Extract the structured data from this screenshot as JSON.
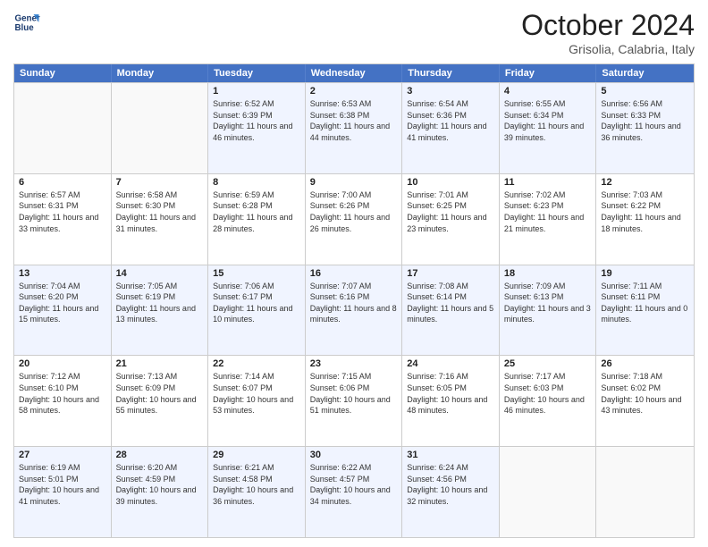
{
  "header": {
    "logo_line1": "General",
    "logo_line2": "Blue",
    "month": "October 2024",
    "location": "Grisolia, Calabria, Italy"
  },
  "weekdays": [
    "Sunday",
    "Monday",
    "Tuesday",
    "Wednesday",
    "Thursday",
    "Friday",
    "Saturday"
  ],
  "rows": [
    [
      {
        "day": "",
        "content": ""
      },
      {
        "day": "",
        "content": ""
      },
      {
        "day": "1",
        "content": "Sunrise: 6:52 AM\nSunset: 6:39 PM\nDaylight: 11 hours and 46 minutes."
      },
      {
        "day": "2",
        "content": "Sunrise: 6:53 AM\nSunset: 6:38 PM\nDaylight: 11 hours and 44 minutes."
      },
      {
        "day": "3",
        "content": "Sunrise: 6:54 AM\nSunset: 6:36 PM\nDaylight: 11 hours and 41 minutes."
      },
      {
        "day": "4",
        "content": "Sunrise: 6:55 AM\nSunset: 6:34 PM\nDaylight: 11 hours and 39 minutes."
      },
      {
        "day": "5",
        "content": "Sunrise: 6:56 AM\nSunset: 6:33 PM\nDaylight: 11 hours and 36 minutes."
      }
    ],
    [
      {
        "day": "6",
        "content": "Sunrise: 6:57 AM\nSunset: 6:31 PM\nDaylight: 11 hours and 33 minutes."
      },
      {
        "day": "7",
        "content": "Sunrise: 6:58 AM\nSunset: 6:30 PM\nDaylight: 11 hours and 31 minutes."
      },
      {
        "day": "8",
        "content": "Sunrise: 6:59 AM\nSunset: 6:28 PM\nDaylight: 11 hours and 28 minutes."
      },
      {
        "day": "9",
        "content": "Sunrise: 7:00 AM\nSunset: 6:26 PM\nDaylight: 11 hours and 26 minutes."
      },
      {
        "day": "10",
        "content": "Sunrise: 7:01 AM\nSunset: 6:25 PM\nDaylight: 11 hours and 23 minutes."
      },
      {
        "day": "11",
        "content": "Sunrise: 7:02 AM\nSunset: 6:23 PM\nDaylight: 11 hours and 21 minutes."
      },
      {
        "day": "12",
        "content": "Sunrise: 7:03 AM\nSunset: 6:22 PM\nDaylight: 11 hours and 18 minutes."
      }
    ],
    [
      {
        "day": "13",
        "content": "Sunrise: 7:04 AM\nSunset: 6:20 PM\nDaylight: 11 hours and 15 minutes."
      },
      {
        "day": "14",
        "content": "Sunrise: 7:05 AM\nSunset: 6:19 PM\nDaylight: 11 hours and 13 minutes."
      },
      {
        "day": "15",
        "content": "Sunrise: 7:06 AM\nSunset: 6:17 PM\nDaylight: 11 hours and 10 minutes."
      },
      {
        "day": "16",
        "content": "Sunrise: 7:07 AM\nSunset: 6:16 PM\nDaylight: 11 hours and 8 minutes."
      },
      {
        "day": "17",
        "content": "Sunrise: 7:08 AM\nSunset: 6:14 PM\nDaylight: 11 hours and 5 minutes."
      },
      {
        "day": "18",
        "content": "Sunrise: 7:09 AM\nSunset: 6:13 PM\nDaylight: 11 hours and 3 minutes."
      },
      {
        "day": "19",
        "content": "Sunrise: 7:11 AM\nSunset: 6:11 PM\nDaylight: 11 hours and 0 minutes."
      }
    ],
    [
      {
        "day": "20",
        "content": "Sunrise: 7:12 AM\nSunset: 6:10 PM\nDaylight: 10 hours and 58 minutes."
      },
      {
        "day": "21",
        "content": "Sunrise: 7:13 AM\nSunset: 6:09 PM\nDaylight: 10 hours and 55 minutes."
      },
      {
        "day": "22",
        "content": "Sunrise: 7:14 AM\nSunset: 6:07 PM\nDaylight: 10 hours and 53 minutes."
      },
      {
        "day": "23",
        "content": "Sunrise: 7:15 AM\nSunset: 6:06 PM\nDaylight: 10 hours and 51 minutes."
      },
      {
        "day": "24",
        "content": "Sunrise: 7:16 AM\nSunset: 6:05 PM\nDaylight: 10 hours and 48 minutes."
      },
      {
        "day": "25",
        "content": "Sunrise: 7:17 AM\nSunset: 6:03 PM\nDaylight: 10 hours and 46 minutes."
      },
      {
        "day": "26",
        "content": "Sunrise: 7:18 AM\nSunset: 6:02 PM\nDaylight: 10 hours and 43 minutes."
      }
    ],
    [
      {
        "day": "27",
        "content": "Sunrise: 6:19 AM\nSunset: 5:01 PM\nDaylight: 10 hours and 41 minutes."
      },
      {
        "day": "28",
        "content": "Sunrise: 6:20 AM\nSunset: 4:59 PM\nDaylight: 10 hours and 39 minutes."
      },
      {
        "day": "29",
        "content": "Sunrise: 6:21 AM\nSunset: 4:58 PM\nDaylight: 10 hours and 36 minutes."
      },
      {
        "day": "30",
        "content": "Sunrise: 6:22 AM\nSunset: 4:57 PM\nDaylight: 10 hours and 34 minutes."
      },
      {
        "day": "31",
        "content": "Sunrise: 6:24 AM\nSunset: 4:56 PM\nDaylight: 10 hours and 32 minutes."
      },
      {
        "day": "",
        "content": ""
      },
      {
        "day": "",
        "content": ""
      }
    ]
  ],
  "alt_rows": [
    0,
    2,
    4
  ]
}
